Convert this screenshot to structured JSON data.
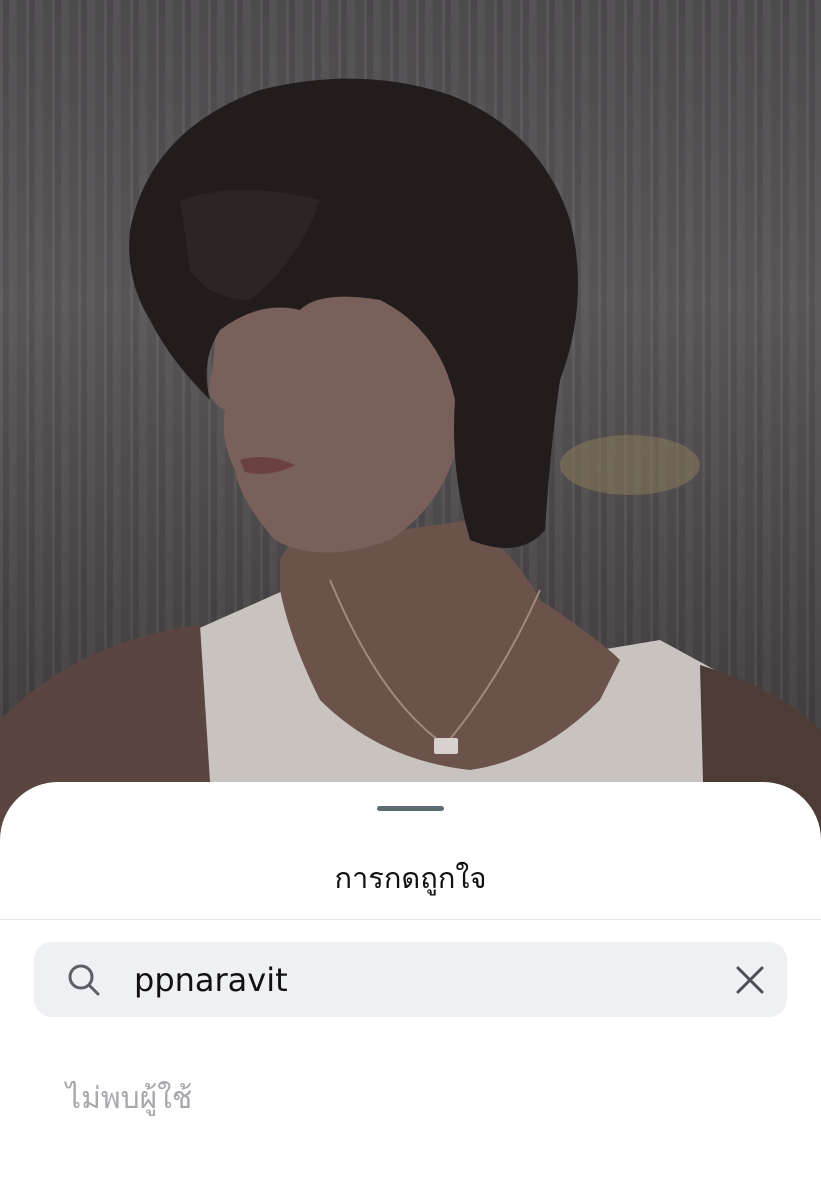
{
  "sheet": {
    "title": "การกดถูกใจ",
    "search": {
      "value": "ppnaravit",
      "icon": "search-icon",
      "clear_icon": "close-icon"
    },
    "empty_message": "ไม่พบผู้ใช้"
  },
  "colors": {
    "sheet_background": "#ffffff",
    "search_background": "#eff0f3",
    "grabber": "#5f6b72",
    "muted_text": "#a6a8ad"
  }
}
